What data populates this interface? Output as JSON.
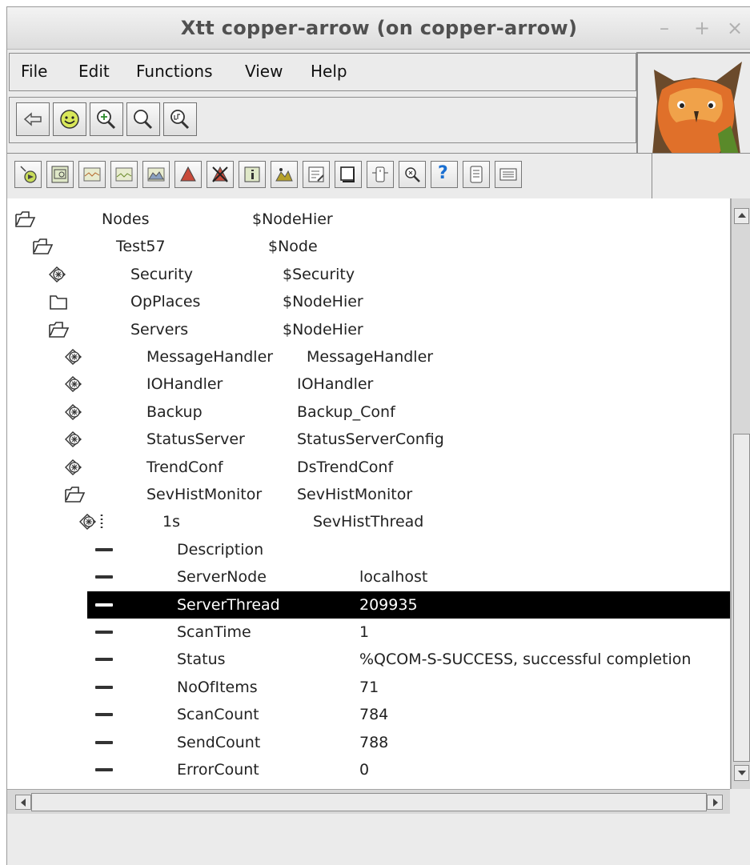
{
  "window": {
    "title": "Xtt copper-arrow (on copper-arrow)",
    "controls": {
      "minimize": "–",
      "maximize": "+",
      "close": "×"
    }
  },
  "menu": {
    "items": [
      {
        "id": "file",
        "label": "File"
      },
      {
        "id": "edit",
        "label": "Edit"
      },
      {
        "id": "functions",
        "label": "Functions"
      },
      {
        "id": "view",
        "label": "View"
      },
      {
        "id": "help",
        "label": "Help"
      }
    ]
  },
  "nav_toolbar": {
    "buttons": [
      "back-arrow-icon",
      "open-object-icon",
      "zoom-in-icon",
      "zoom-reset-icon",
      "zoom-out-icon"
    ]
  },
  "toolbar": {
    "buttons": [
      "open-plc-icon",
      "open-graph-icon",
      "trend-icon",
      "fast-curve-icon",
      "history-icon",
      "alarm-icon",
      "block-alarm-icon",
      "object-info-icon",
      "history-curve-icon",
      "crossref-icon",
      "window-icon",
      "class-graph-icon",
      "search-icon",
      "help-icon",
      "list-icon",
      "display-icon"
    ],
    "help_symbol": "?"
  },
  "tree": {
    "rows": [
      {
        "type": "folder-open",
        "name": "Nodes",
        "class": "$NodeHier",
        "selected": false
      },
      {
        "type": "folder-open",
        "name": "Test57",
        "class": "$Node",
        "selected": false
      },
      {
        "type": "object",
        "name": "Security",
        "class": "$Security",
        "selected": false
      },
      {
        "type": "folder-closed",
        "name": "OpPlaces",
        "class": "$NodeHier",
        "selected": false
      },
      {
        "type": "folder-open",
        "name": "Servers",
        "class": "$NodeHier",
        "selected": false
      },
      {
        "type": "object",
        "name": "MessageHandler",
        "class": "MessageHandler",
        "selected": false
      },
      {
        "type": "object",
        "name": "IOHandler",
        "class": "IOHandler",
        "selected": false
      },
      {
        "type": "object",
        "name": "Backup",
        "class": "Backup_Conf",
        "selected": false
      },
      {
        "type": "object",
        "name": "StatusServer",
        "class": "StatusServerConfig",
        "selected": false
      },
      {
        "type": "object",
        "name": "TrendConf",
        "class": "DsTrendConf",
        "selected": false
      },
      {
        "type": "folder-open",
        "name": "SevHistMonitor",
        "class": "SevHistMonitor",
        "selected": false
      },
      {
        "type": "object-open",
        "name": "1s",
        "class": "SevHistThread",
        "selected": false
      },
      {
        "type": "attr",
        "name": "Description",
        "value": "",
        "selected": false
      },
      {
        "type": "attr",
        "name": "ServerNode",
        "value": "localhost",
        "selected": false
      },
      {
        "type": "attr",
        "name": "ServerThread",
        "value": "209935",
        "selected": true
      },
      {
        "type": "attr",
        "name": "ScanTime",
        "value": "1",
        "selected": false
      },
      {
        "type": "attr",
        "name": "Status",
        "value": "%QCOM-S-SUCCESS, successful completion",
        "selected": false
      },
      {
        "type": "attr",
        "name": "NoOfItems",
        "value": "71",
        "selected": false
      },
      {
        "type": "attr",
        "name": "ScanCount",
        "value": "784",
        "selected": false
      },
      {
        "type": "attr",
        "name": "SendCount",
        "value": "788",
        "selected": false
      },
      {
        "type": "attr",
        "name": "ErrorCount",
        "value": "0",
        "selected": false
      }
    ]
  },
  "colors": {
    "selection": "#000000",
    "help_icon": "#1a6fd1",
    "owl_orange": "#e0702a"
  }
}
